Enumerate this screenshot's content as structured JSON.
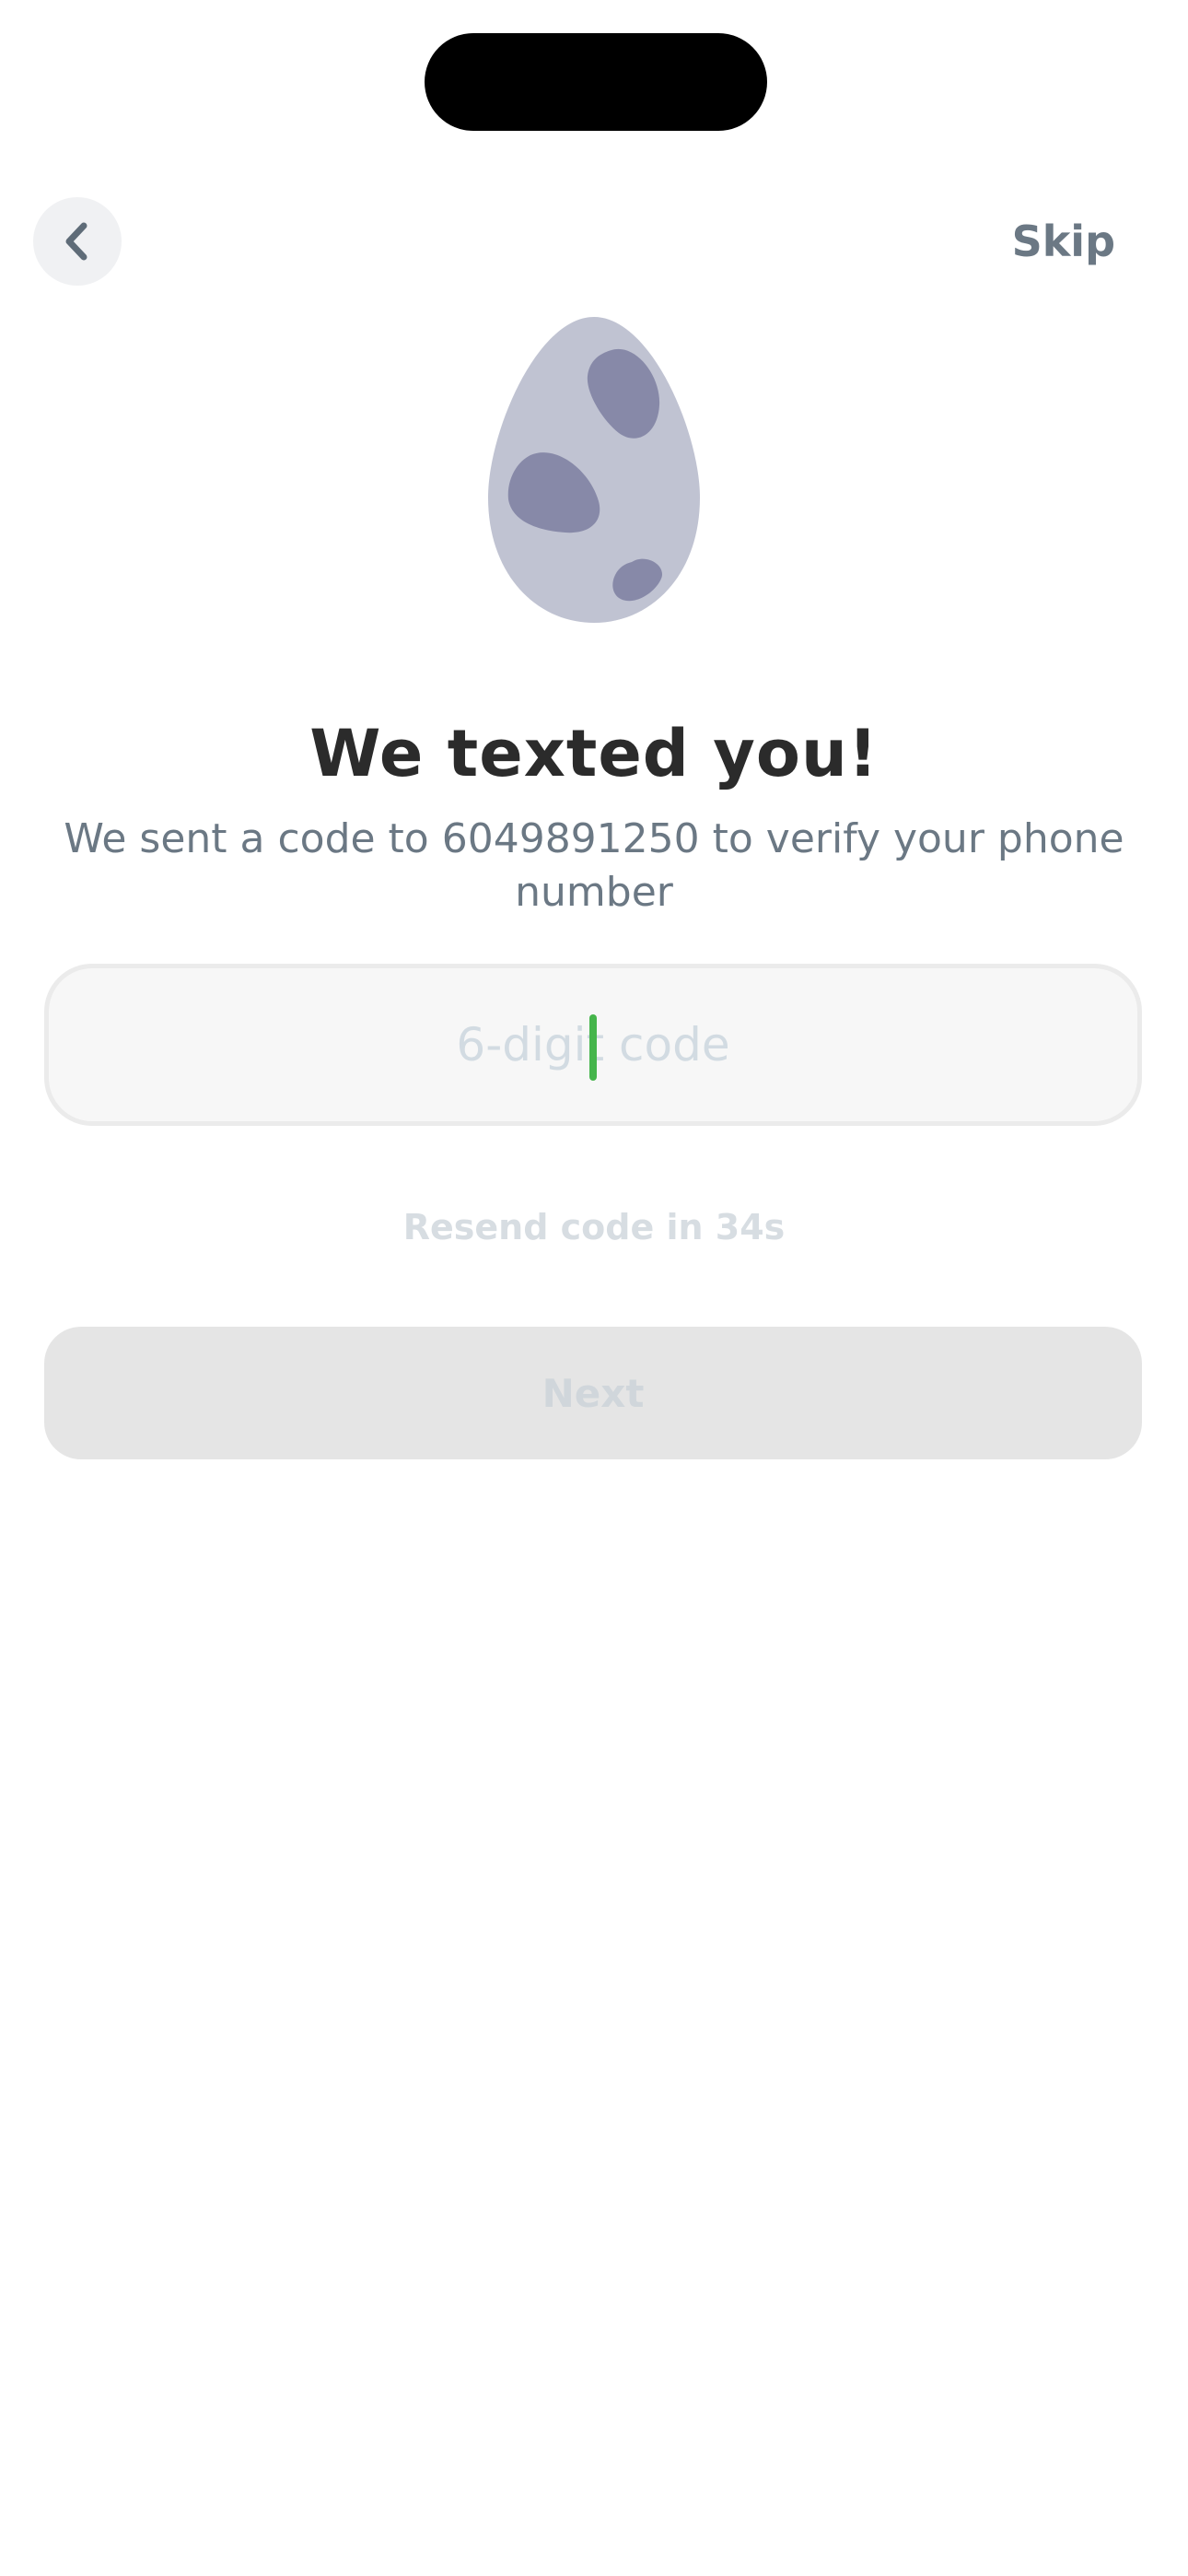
{
  "header": {
    "back_icon": "chevron-left-icon",
    "skip_label": "Skip"
  },
  "illustration": {
    "icon": "egg-icon",
    "colors": {
      "shell": "#c0c3d2",
      "spots": "#8789a8"
    }
  },
  "main": {
    "title": "We texted you!",
    "subtitle": "We sent a code to 6049891250 to verify your phone number"
  },
  "code_input": {
    "placeholder": "6-digit code",
    "value": ""
  },
  "resend": {
    "text": "Resend code in 34s"
  },
  "next_button": {
    "label": "Next",
    "disabled": true
  },
  "colors": {
    "caret": "#45b54b",
    "title": "#2b2b2b",
    "secondary_text": "#6b7884"
  }
}
